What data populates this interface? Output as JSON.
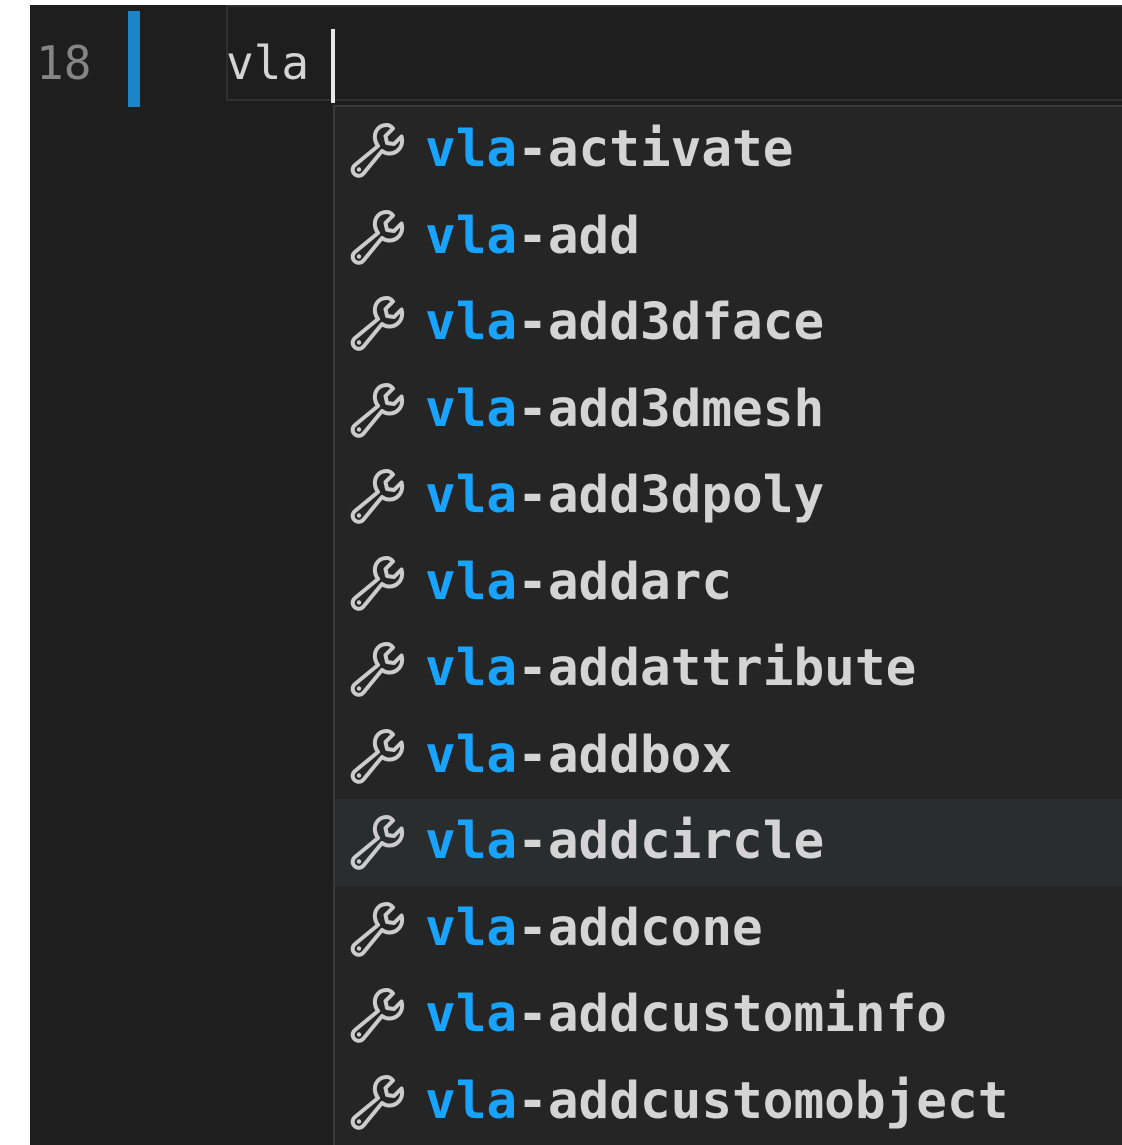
{
  "editor": {
    "line_number": "18",
    "typed_text": "vla",
    "background": "#1e1e1e",
    "gutter_marker_color": "#1a85c8"
  },
  "suggestions": {
    "icon": "wrench-icon",
    "match_color": "#18a3ff",
    "text_color": "#d4d4d4",
    "focused_index": 8,
    "items": [
      {
        "match": "vla",
        "rest": "-activate"
      },
      {
        "match": "vla",
        "rest": "-add"
      },
      {
        "match": "vla",
        "rest": "-add3dface"
      },
      {
        "match": "vla",
        "rest": "-add3dmesh"
      },
      {
        "match": "vla",
        "rest": "-add3dpoly"
      },
      {
        "match": "vla",
        "rest": "-addarc"
      },
      {
        "match": "vla",
        "rest": "-addattribute"
      },
      {
        "match": "vla",
        "rest": "-addbox"
      },
      {
        "match": "vla",
        "rest": "-addcircle"
      },
      {
        "match": "vla",
        "rest": "-addcone"
      },
      {
        "match": "vla",
        "rest": "-addcustominfo"
      },
      {
        "match": "vla",
        "rest": "-addcustomobject"
      }
    ]
  }
}
